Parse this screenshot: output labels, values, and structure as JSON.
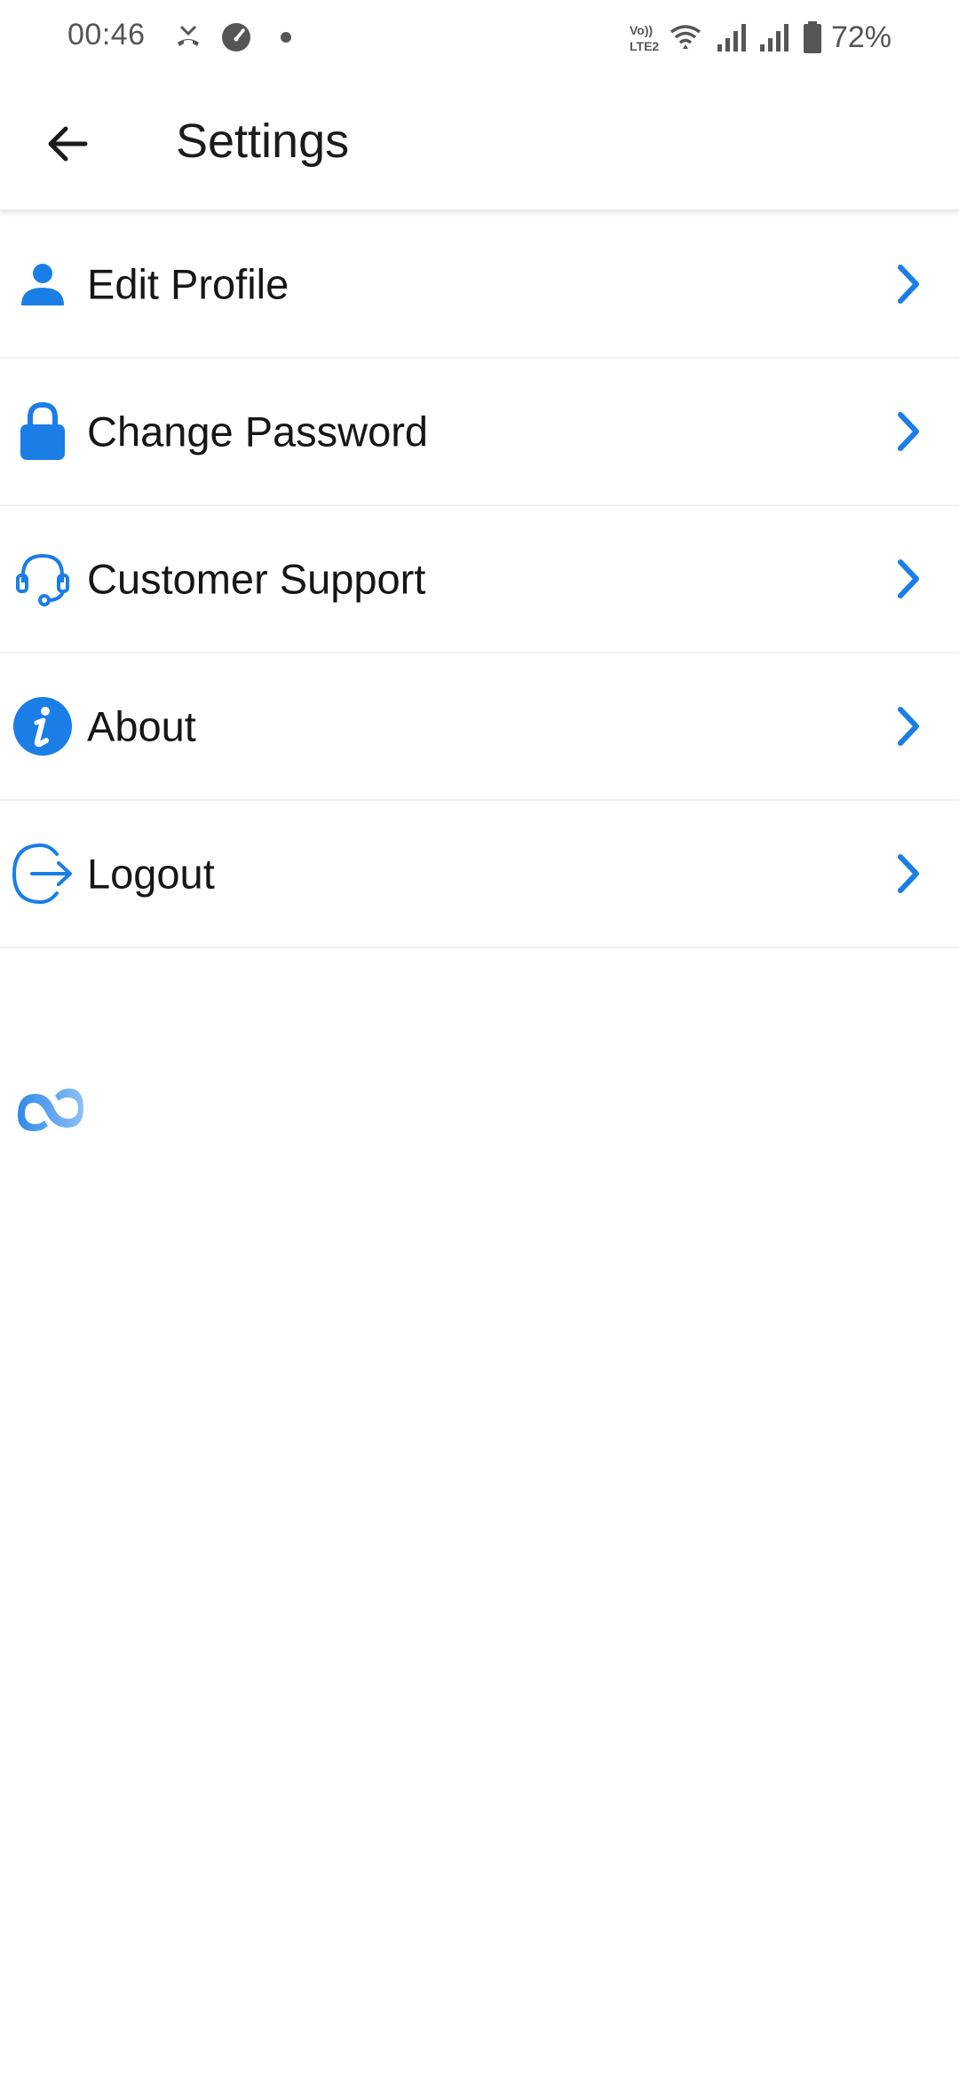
{
  "status_bar": {
    "time": "00:46",
    "battery": "72%",
    "left_icons": [
      "missed-call-icon",
      "speedometer-icon",
      "notification-dot-icon"
    ],
    "right_icons": [
      "volte-lte2-icon",
      "wifi-icon",
      "signal-icon",
      "signal-icon",
      "battery-icon"
    ]
  },
  "app_bar": {
    "title": "Settings",
    "back_icon": "arrow-left-icon"
  },
  "menu": {
    "items": [
      {
        "label": "Edit Profile",
        "icon": "person-icon"
      },
      {
        "label": "Change Password",
        "icon": "lock-icon"
      },
      {
        "label": "Customer Support",
        "icon": "headset-icon"
      },
      {
        "label": "About",
        "icon": "info-icon"
      },
      {
        "label": "Logout",
        "icon": "logout-icon"
      }
    ]
  },
  "loader_icon": "loading-spinner-icon",
  "colors": {
    "accent": "#1a7ee6",
    "text": "#161616",
    "status_text": "#555555",
    "divider": "#f1f1f1"
  }
}
